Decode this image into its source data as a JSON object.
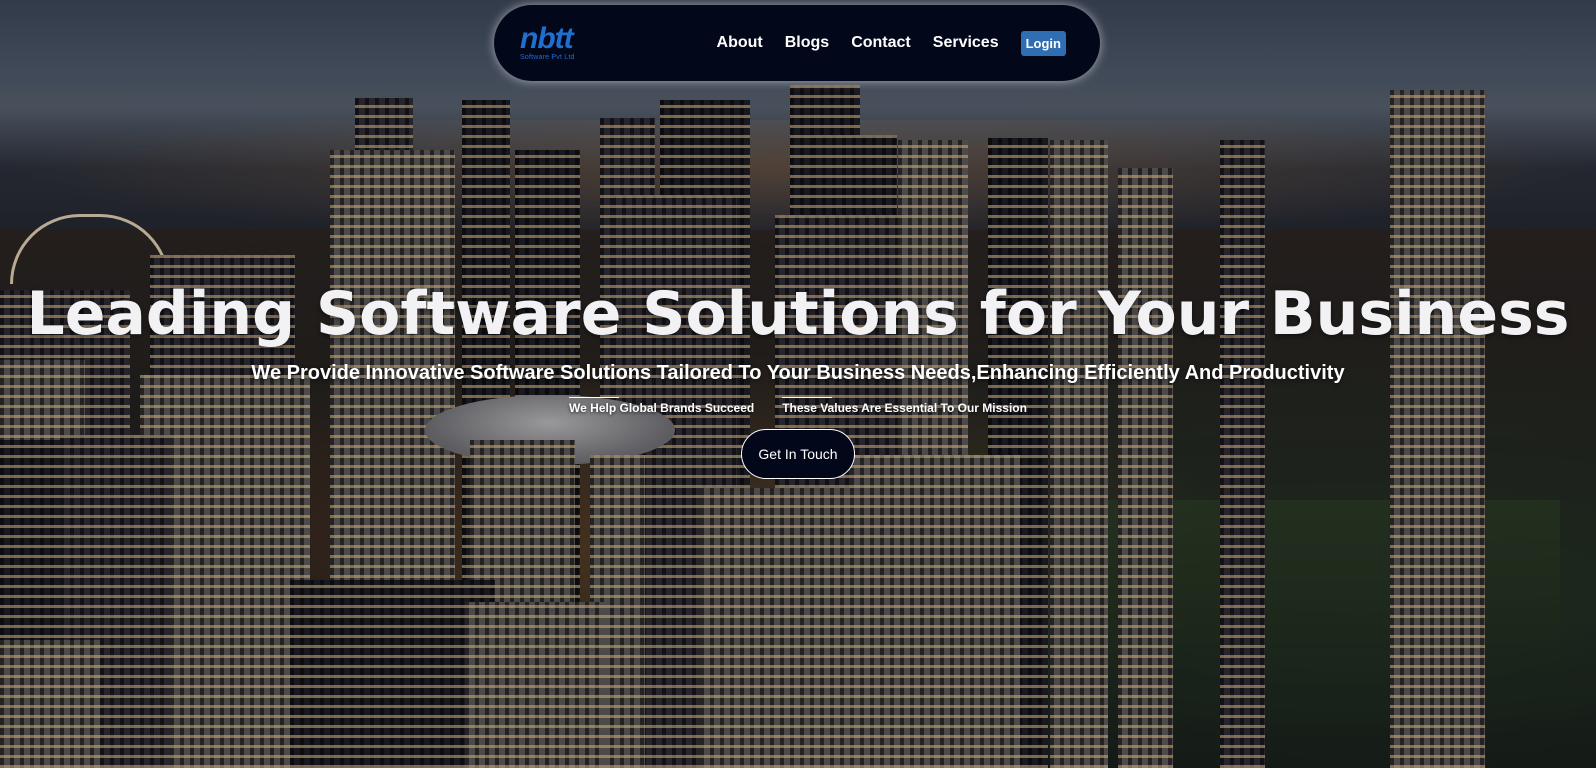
{
  "brand": {
    "logo_text": "nbtt",
    "logo_subtext": "Software Pvt Ltd",
    "accent_color": "#1f6fd1"
  },
  "nav": {
    "links": [
      {
        "label": "About"
      },
      {
        "label": "Blogs"
      },
      {
        "label": "Contact"
      },
      {
        "label": "Services"
      }
    ],
    "login_label": "Login"
  },
  "hero": {
    "title": "Leading Software Solutions for Your Business",
    "subtitle": "We Provide Innovative Software Solutions Tailored To Your Business Needs,Enhancing Efficiently And Productivity",
    "values": [
      {
        "label": "We Help Global Brands Succeed"
      },
      {
        "label": "These Values Are Essential To Our Mission"
      }
    ],
    "cta_label": "Get In Touch"
  }
}
